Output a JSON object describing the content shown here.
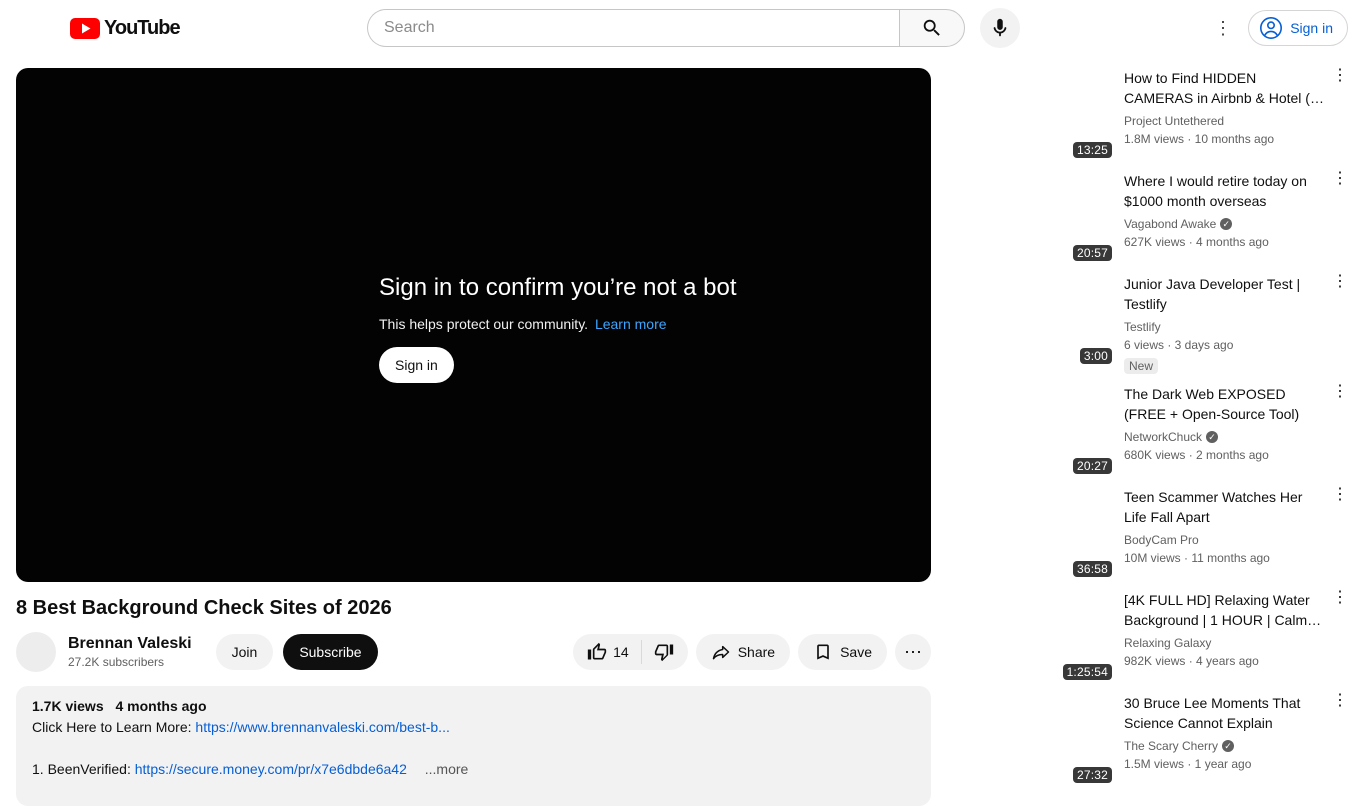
{
  "header": {
    "search_placeholder": "Search",
    "signin_label": "Sign in",
    "icons": {
      "kebab_vertical": "⋮",
      "more_horizontal": "⋯",
      "verified_check": "✓"
    }
  },
  "player": {
    "bot_title": "Sign in to confirm you’re not a bot",
    "bot_subtitle": "This helps protect our community.",
    "learn_more_label": "Learn more",
    "signin_button_label": "Sign in"
  },
  "video": {
    "title": "8 Best Background Check Sites of 2026",
    "channel_name": "Brennan Valeski",
    "subscribers": "27.2K subscribers",
    "join_label": "Join",
    "subscribe_label": "Subscribe",
    "like_count": "14",
    "share_label": "Share",
    "save_label": "Save"
  },
  "description": {
    "views": "1.7K views",
    "date": "4 months ago",
    "line1_label": "Click Here to Learn More:",
    "line1_link": "https://www.brennanvaleski.com/best-b...",
    "line2_label": "1. BeenVerified:",
    "line2_link": "https://secure.money.com/pr/x7e6dbde6a42",
    "more_label": "...more"
  },
  "sidebar": {
    "new_badge_label": "New",
    "items": [
      {
        "title": "How to Find HIDDEN CAMERAS in Airbnb & Hotel (…",
        "channel": "Project Untethered",
        "verified": false,
        "meta": "1.8M views · 10 months ago",
        "duration": "13:25",
        "is_new": false
      },
      {
        "title": "Where I would retire today on $1000 month overseas",
        "channel": "Vagabond Awake",
        "verified": true,
        "meta": "627K views · 4 months ago",
        "duration": "20:57",
        "is_new": false
      },
      {
        "title": "Junior Java Developer Test | Testlify",
        "channel": "Testlify",
        "verified": false,
        "meta": "6 views · 3 days ago",
        "duration": "3:00",
        "is_new": true
      },
      {
        "title": "The Dark Web EXPOSED (FREE + Open-Source Tool)",
        "channel": "NetworkChuck",
        "verified": true,
        "meta": "680K views · 2 months ago",
        "duration": "20:27",
        "is_new": false
      },
      {
        "title": "Teen Scammer Watches Her Life Fall Apart",
        "channel": "BodyCam Pro",
        "verified": false,
        "meta": "10M views · 11 months ago",
        "duration": "36:58",
        "is_new": false
      },
      {
        "title": "[4K FULL HD] Relaxing Water Background | 1 HOUR | Calm …",
        "channel": "Relaxing Galaxy",
        "verified": false,
        "meta": "982K views · 4 years ago",
        "duration": "1:25:54",
        "is_new": false
      },
      {
        "title": "30 Bruce Lee Moments That Science Cannot Explain",
        "channel": "The Scary Cherry",
        "verified": true,
        "meta": "1.5M views · 1 year ago",
        "duration": "27:32",
        "is_new": false
      }
    ]
  },
  "colors": {
    "brand_red": "#ff0000",
    "accent_blue": "#065fd4",
    "link_light_blue": "#3ea6ff"
  }
}
